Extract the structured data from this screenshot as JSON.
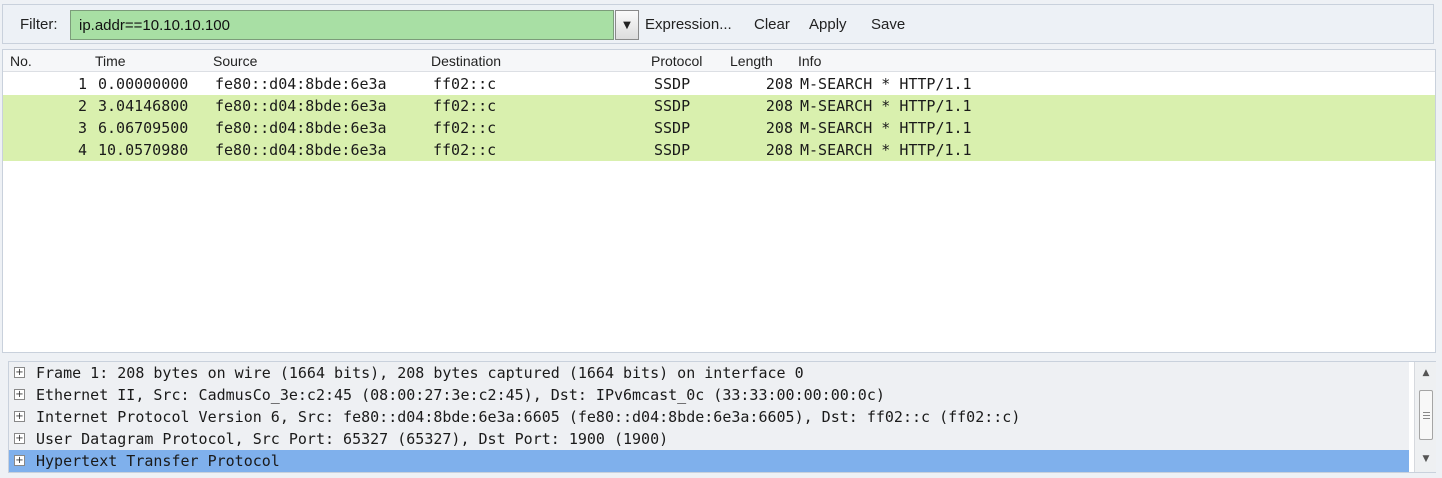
{
  "toolbar": {
    "filter_label": "Filter:",
    "filter_value": "ip.addr==10.10.10.100",
    "dropdown_glyph": "▼",
    "expression_label": "Expression...",
    "clear_label": "Clear",
    "apply_label": "Apply",
    "save_label": "Save"
  },
  "packet_list": {
    "columns": [
      "No.",
      "Time",
      "Source",
      "Destination",
      "Protocol",
      "Length",
      "Info"
    ],
    "rows": [
      {
        "no": "1",
        "time": "0.00000000",
        "src": "fe80::d04:8bde:6e3a",
        "dst": "ff02::c",
        "proto": "SSDP",
        "len": "208",
        "info": "M-SEARCH * HTTP/1.1"
      },
      {
        "no": "2",
        "time": "3.04146800",
        "src": "fe80::d04:8bde:6e3a",
        "dst": "ff02::c",
        "proto": "SSDP",
        "len": "208",
        "info": "M-SEARCH * HTTP/1.1"
      },
      {
        "no": "3",
        "time": "6.06709500",
        "src": "fe80::d04:8bde:6e3a",
        "dst": "ff02::c",
        "proto": "SSDP",
        "len": "208",
        "info": "M-SEARCH * HTTP/1.1"
      },
      {
        "no": "4",
        "time": "10.0570980",
        "src": "fe80::d04:8bde:6e3a",
        "dst": "ff02::c",
        "proto": "SSDP",
        "len": "208",
        "info": "M-SEARCH * HTTP/1.1"
      }
    ]
  },
  "details": {
    "expander_glyph": "+",
    "items": [
      "Frame 1: 208 bytes on wire (1664 bits), 208 bytes captured (1664 bits) on interface 0",
      "Ethernet II, Src: CadmusCo_3e:c2:45 (08:00:27:3e:c2:45), Dst: IPv6mcast_0c (33:33:00:00:00:0c)",
      "Internet Protocol Version 6, Src: fe80::d04:8bde:6e3a:6605 (fe80::d04:8bde:6e3a:6605), Dst: ff02::c (ff02::c)",
      "User Datagram Protocol, Src Port: 65327 (65327), Dst Port: 1900 (1900)",
      "Hypertext Transfer Protocol"
    ],
    "scroll_up_glyph": "▲",
    "scroll_down_glyph": "▼"
  },
  "colors": {
    "filter_valid_bg": "#a8dfa4",
    "row_white": "#ffffff",
    "row_green": "#d9f0ae",
    "selection_blue": "#7fb0ec"
  }
}
